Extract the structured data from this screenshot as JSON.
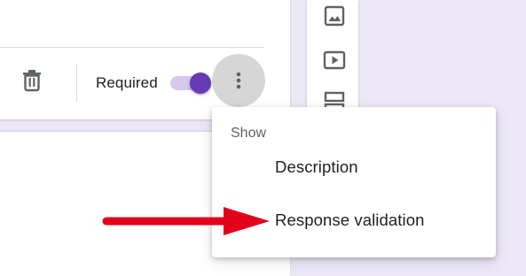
{
  "question_footer": {
    "delete_icon": "trash-icon",
    "required_label": "Required",
    "required_on": true,
    "more_icon": "more-vert-icon"
  },
  "side_toolbar": {
    "tools": [
      "add-image-icon",
      "add-video-icon",
      "add-section-icon"
    ]
  },
  "options_menu": {
    "header": "Show",
    "items": [
      {
        "label": "Description"
      },
      {
        "label": "Response validation"
      }
    ]
  },
  "colors": {
    "accent": "#673ab7",
    "toggle_track": "#d4c8ee",
    "page_background": "#ece8f7",
    "annotation_arrow": "#e3001b"
  }
}
